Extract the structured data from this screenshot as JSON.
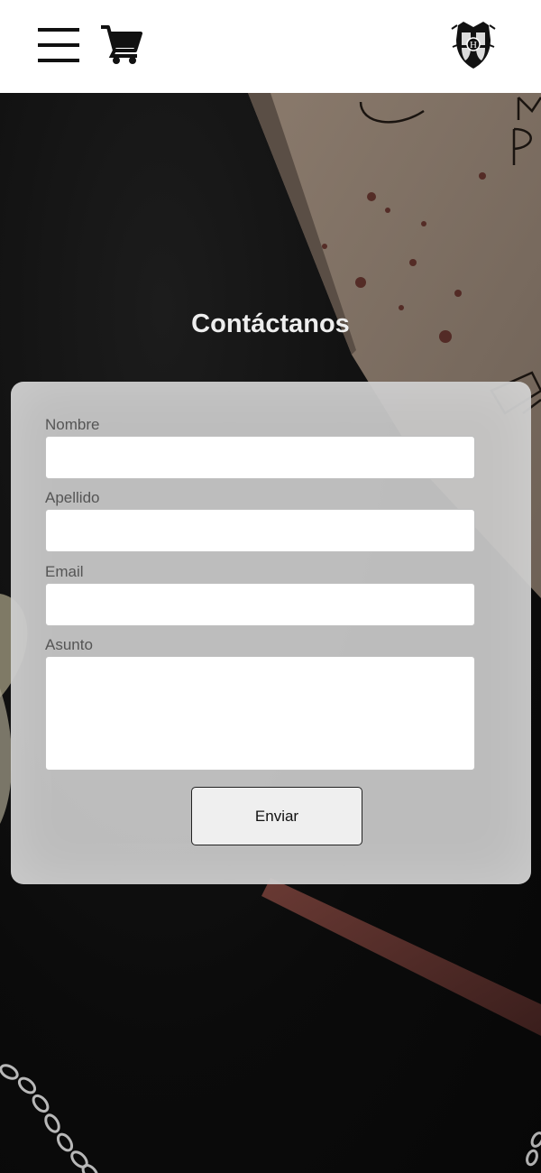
{
  "header": {
    "menu_icon": "hamburger-menu-icon",
    "cart_icon": "shopping-cart-icon",
    "logo_icon": "hogwarts-crest-logo"
  },
  "page": {
    "title": "Contáctanos"
  },
  "form": {
    "fields": [
      {
        "label": "Nombre",
        "value": "",
        "type": "text"
      },
      {
        "label": "Apellido",
        "value": "",
        "type": "text"
      },
      {
        "label": "Email",
        "value": "",
        "type": "email"
      },
      {
        "label": "Asunto",
        "value": "",
        "type": "textarea"
      }
    ],
    "submit_label": "Enviar"
  },
  "colors": {
    "header_bg": "#ffffff",
    "card_bg": "#c8c8c8",
    "title": "#eeeeee",
    "label": "#555555",
    "button_bg": "#efefef"
  }
}
